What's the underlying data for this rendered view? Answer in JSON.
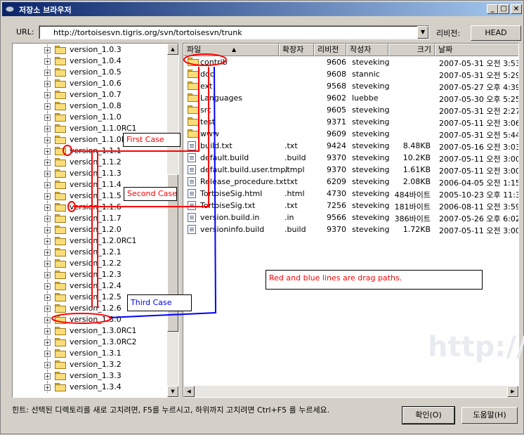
{
  "window": {
    "title": "저장소 브라우저",
    "controls": [
      "_",
      "□",
      "×"
    ]
  },
  "toolbar": {
    "url_label": "URL:",
    "url_value": "http://tortoisesvn.tigris.org/svn/tortoisesvn/trunk",
    "revision_label": "리비전:",
    "head_button": "HEAD"
  },
  "tree": {
    "items": [
      "version_1.0.3",
      "version_1.0.4",
      "version_1.0.5",
      "version_1.0.6",
      "version_1.0.7",
      "version_1.0.8",
      "version_1.1.0",
      "version_1.1.0RC1",
      "version_1.1.0RC",
      "version_1.1.1",
      "version_1.1.2",
      "version_1.1.3",
      "version_1.1.4",
      "version_1.1.5",
      "version_1.1.6",
      "version_1.1.7",
      "version_1.2.0",
      "version_1.2.0RC1",
      "version_1.2.1",
      "version_1.2.2",
      "version_1.2.3",
      "version_1.2.4",
      "version_1.2.5",
      "version_1.2.6",
      "version_1.3.0",
      "version_1.3.0RC1",
      "version_1.3.0RC2",
      "version_1.3.1",
      "version_1.3.2",
      "version_1.3.3",
      "version_1.3.4"
    ]
  },
  "list": {
    "columns": [
      "파일",
      "확장자",
      "리비전",
      "작성자",
      "크기",
      "날짜"
    ],
    "rows": [
      {
        "name": "contrib",
        "ext": "",
        "rev": "9606",
        "author": "steveking",
        "size": "",
        "date": "2007-05-31 오전 3:53",
        "type": "folder"
      },
      {
        "name": "doc",
        "ext": "",
        "rev": "9608",
        "author": "stannic",
        "size": "",
        "date": "2007-05-31 오전 5:29",
        "type": "folder"
      },
      {
        "name": "ext",
        "ext": "",
        "rev": "9568",
        "author": "steveking",
        "size": "",
        "date": "2007-05-27 오후 4:39",
        "type": "folder"
      },
      {
        "name": "Languages",
        "ext": "",
        "rev": "9602",
        "author": "luebbe",
        "size": "",
        "date": "2007-05-30 오후 5:25",
        "type": "folder"
      },
      {
        "name": "src",
        "ext": "",
        "rev": "9605",
        "author": "steveking",
        "size": "",
        "date": "2007-05-31 오전 2:27",
        "type": "folder"
      },
      {
        "name": "test",
        "ext": "",
        "rev": "9371",
        "author": "steveking",
        "size": "",
        "date": "2007-05-11 오전 3:06",
        "type": "folder"
      },
      {
        "name": "www",
        "ext": "",
        "rev": "9609",
        "author": "steveking",
        "size": "",
        "date": "2007-05-31 오전 5:44",
        "type": "folder"
      },
      {
        "name": "build.txt",
        "ext": ".txt",
        "rev": "9424",
        "author": "steveking",
        "size": "8.48KB",
        "date": "2007-05-16 오전 3:03",
        "type": "file"
      },
      {
        "name": "default.build",
        "ext": ".build",
        "rev": "9370",
        "author": "steveking",
        "size": "10.2KB",
        "date": "2007-05-11 오전 3:00",
        "type": "file"
      },
      {
        "name": "default.build.user.tmpl",
        "ext": ".tmpl",
        "rev": "9370",
        "author": "steveking",
        "size": "1.61KB",
        "date": "2007-05-11 오전 3:00",
        "type": "file"
      },
      {
        "name": "Release_procedure.txt",
        "ext": ".txt",
        "rev": "6209",
        "author": "steveking",
        "size": "2.08KB",
        "date": "2006-04-05 오전 1:15",
        "type": "file"
      },
      {
        "name": "TortoiseSig.html",
        "ext": ".html",
        "rev": "4730",
        "author": "steveking",
        "size": "484바이트",
        "date": "2005-10-23 오후 11:3",
        "type": "file"
      },
      {
        "name": "TortoiseSig.txt",
        "ext": ".txt",
        "rev": "7256",
        "author": "steveking",
        "size": "181바이트",
        "date": "2006-08-11 오전 3:59",
        "type": "file"
      },
      {
        "name": "version.build.in",
        "ext": ".in",
        "rev": "9566",
        "author": "steveking",
        "size": "386바이트",
        "date": "2007-05-26 오후 6:02",
        "type": "file"
      },
      {
        "name": "versioninfo.build",
        "ext": ".build",
        "rev": "9370",
        "author": "steveking",
        "size": "1.72KB",
        "date": "2007-05-11 오전 3:00",
        "type": "file"
      }
    ]
  },
  "watermark": "http://",
  "annotations": {
    "first_case": "First Case",
    "second_case": "Second Case",
    "third_case": "Third Case",
    "note": "Red and blue lines are drag paths."
  },
  "footer": {
    "hint": "힌트: 선택된 디렉토리를 새로 고치려면, F5를 누르시고, 하위까지 고치려면 Ctrl+F5 를 누르세요.",
    "ok_button": "확인(O)",
    "help_button": "도움말(H)"
  },
  "colors": {
    "drag_red": "#ff0000",
    "drag_blue": "#0000ff"
  }
}
